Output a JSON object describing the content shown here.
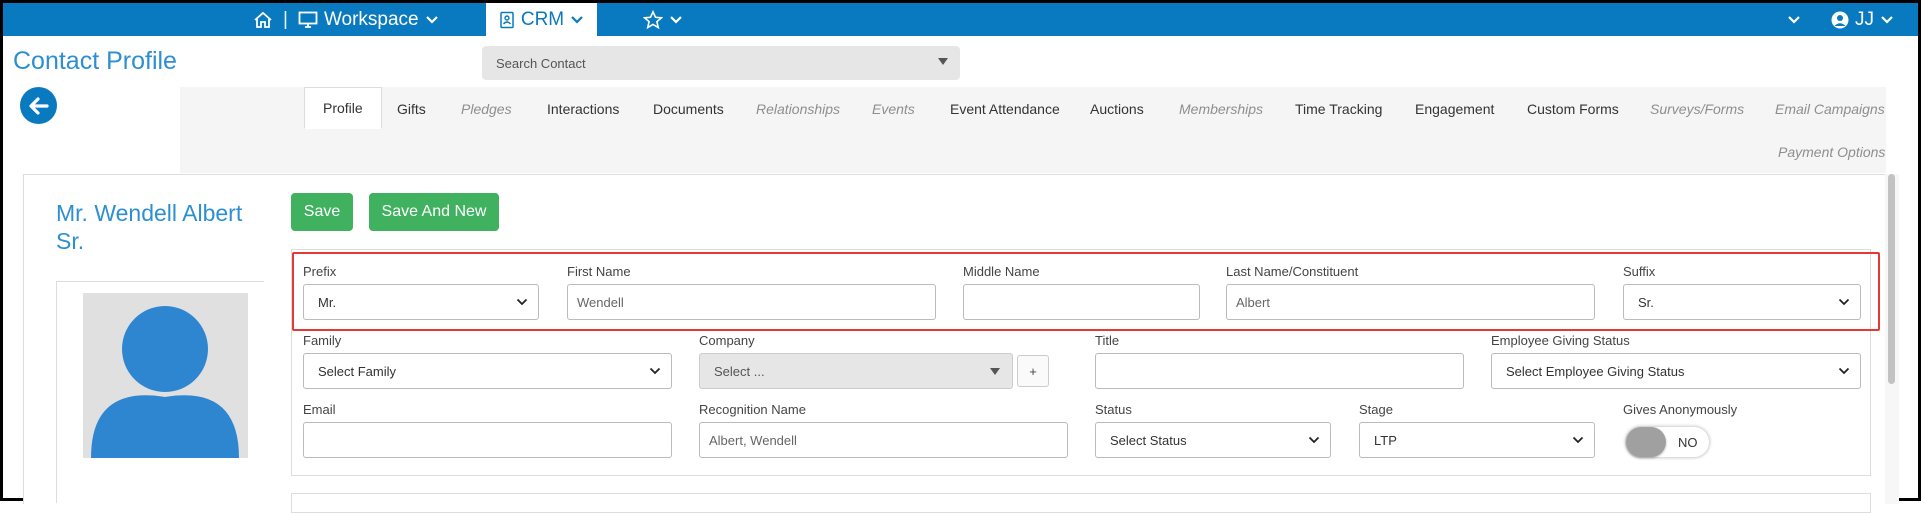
{
  "topbar": {
    "workspace_label": "Workspace",
    "crm_label": "CRM",
    "user_initials": "JJ",
    "accent_color": "#0a7ac0"
  },
  "header": {
    "title": "Contact Profile",
    "search_placeholder": "Search Contact"
  },
  "tabs": [
    {
      "label": "Profile",
      "active": true
    },
    {
      "label": "Gifts"
    },
    {
      "label": "Pledges",
      "muted": true
    },
    {
      "label": "Interactions"
    },
    {
      "label": "Documents"
    },
    {
      "label": "Relationships",
      "muted": true
    },
    {
      "label": "Events",
      "muted": true
    },
    {
      "label": "Event Attendance"
    },
    {
      "label": "Auctions"
    },
    {
      "label": "Memberships",
      "muted": true
    },
    {
      "label": "Time Tracking"
    },
    {
      "label": "Engagement"
    },
    {
      "label": "Custom Forms"
    },
    {
      "label": "Surveys/Forms",
      "muted": true
    },
    {
      "label": "Email Campaigns",
      "muted": true
    },
    {
      "label": "Payment Options",
      "muted": true
    }
  ],
  "contact": {
    "name_line1": "Mr. Wendell Albert",
    "name_line2": "Sr."
  },
  "actions": {
    "save": "Save",
    "save_and_new": "Save And New"
  },
  "form": {
    "prefix": {
      "label": "Prefix",
      "value": "Mr."
    },
    "first_name": {
      "label": "First Name",
      "value": "Wendell"
    },
    "middle_name": {
      "label": "Middle Name",
      "value": ""
    },
    "last_name": {
      "label": "Last Name/Constituent",
      "value": "Albert"
    },
    "suffix": {
      "label": "Suffix",
      "value": "Sr."
    },
    "family": {
      "label": "Family",
      "value": "Select Family"
    },
    "company": {
      "label": "Company",
      "value": "Select ..."
    },
    "company_add": "+",
    "title": {
      "label": "Title",
      "value": ""
    },
    "employee_giving": {
      "label": "Employee Giving Status",
      "value": "Select Employee Giving Status"
    },
    "email": {
      "label": "Email",
      "value": ""
    },
    "recognition_name": {
      "label": "Recognition Name",
      "value": "Albert, Wendell"
    },
    "status": {
      "label": "Status",
      "value": "Select Status"
    },
    "stage": {
      "label": "Stage",
      "value": "LTP"
    },
    "gives_anonymously": {
      "label": "Gives Anonymously",
      "value": "NO"
    }
  },
  "colors": {
    "primary": "#0a7ac0",
    "title_blue": "#2e8fd0",
    "save_green": "#3fb15f",
    "highlight_red": "#e53935"
  }
}
